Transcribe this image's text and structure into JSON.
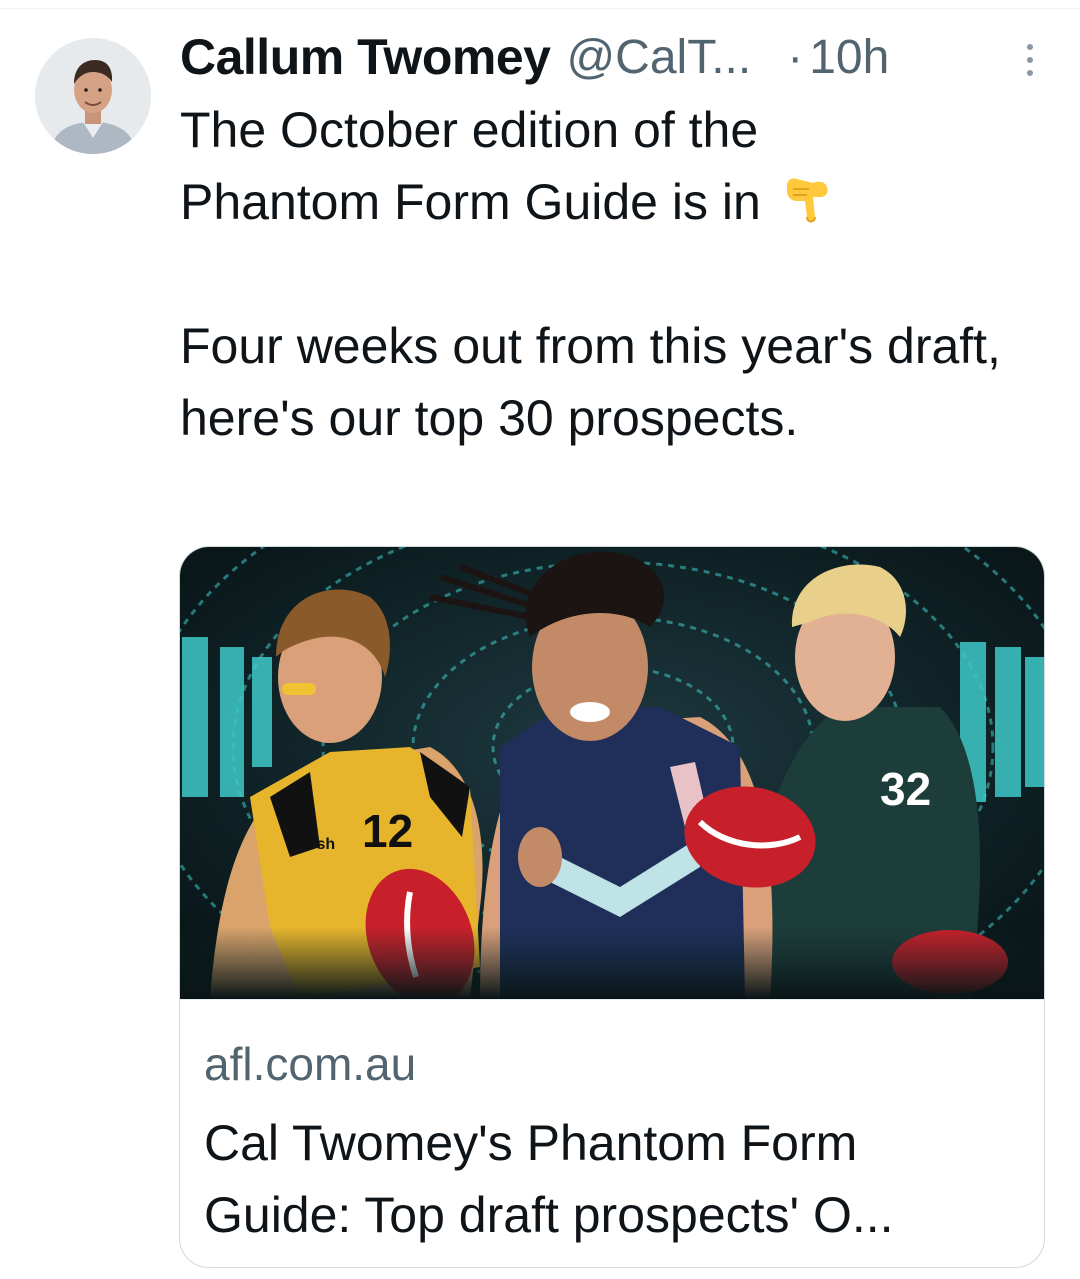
{
  "tweet": {
    "author": {
      "display_name": "Callum Twomey",
      "handle": "@CalT...",
      "avatar_icon": "profile-photo"
    },
    "separator": "·",
    "timestamp": "10h",
    "more_icon": "more-vertical-icon",
    "text": {
      "paragraph1_line1": "The October edition of the",
      "paragraph1_line2": "Phantom Form Guide is in",
      "emoji": "backhand-index-pointing-down",
      "paragraph2": "Four weeks out from this year's draft, here's our top 30 prospects."
    },
    "link_card": {
      "image_description_icon": "draft-prospects-image",
      "player_numbers": [
        "12",
        "32"
      ],
      "sponsor_text": "Marsh",
      "domain": "afl.com.au",
      "title": "Cal Twomey's Phantom Form Guide: Top draft prospects' O..."
    }
  },
  "colors": {
    "text_primary": "#0f1419",
    "text_secondary": "#536471",
    "border": "#cfd9de",
    "image_bg_dark": "#0c1a1d",
    "image_teal": "#3fc9c9",
    "jersey_yellow": "#e7b52b",
    "jersey_navy": "#1f2f5a",
    "jersey_green": "#1d3d3a",
    "football_red": "#c8202a"
  }
}
